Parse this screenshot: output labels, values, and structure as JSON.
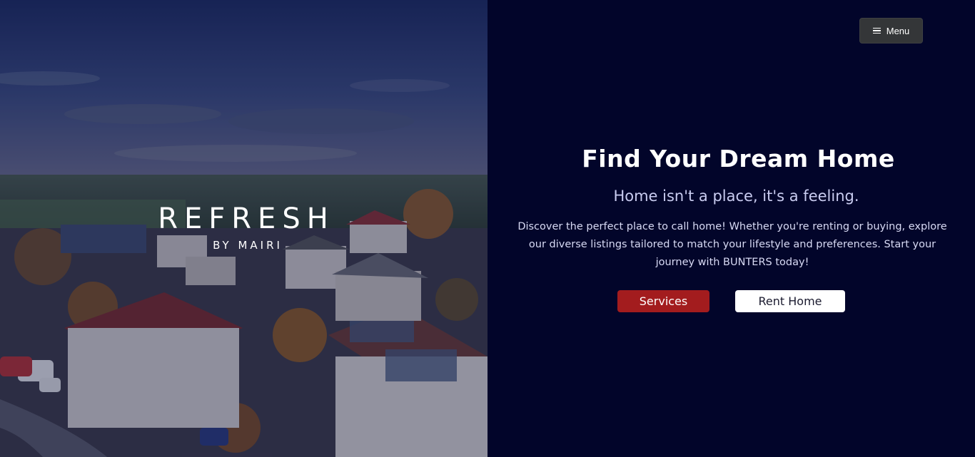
{
  "hero": {
    "brand": "REFRESH",
    "subbrand": "BY MAIRI"
  },
  "nav": {
    "menu_label": "Menu",
    "menu_icon": "hamburger-icon"
  },
  "main": {
    "headline": "Find Your Dream Home",
    "tagline": "Home isn't a place, it's a feeling.",
    "description": "Discover the perfect place to call home! Whether you're renting or buying, explore our diverse listings tailored to match your lifestyle and preferences. Start your journey with BUNTERS today!",
    "services_label": "Services",
    "rent_label": "Rent Home"
  },
  "colors": {
    "panel_bg": "#02052a",
    "services_button": "#a31c1e",
    "rent_button": "#ffffff",
    "menu_button": "#343638"
  }
}
